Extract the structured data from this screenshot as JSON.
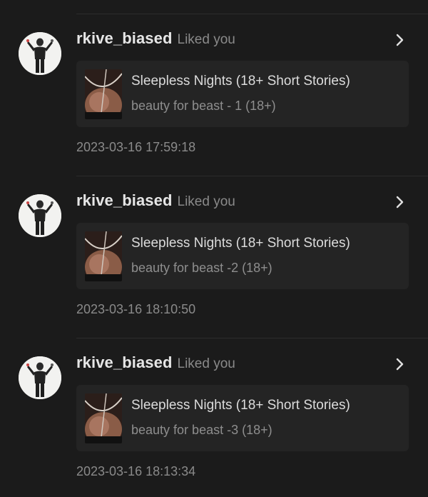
{
  "notifications": [
    {
      "username": "rkive_biased",
      "action": "Liked you",
      "story_title": "Sleepless Nights (18+ Short Stories)",
      "chapter_title": "beauty for beast - 1 (18+)",
      "timestamp": "2023-03-16 17:59:18"
    },
    {
      "username": "rkive_biased",
      "action": "Liked you",
      "story_title": "Sleepless Nights (18+ Short Stories)",
      "chapter_title": "beauty for beast -2 (18+)",
      "timestamp": "2023-03-16 18:10:50"
    },
    {
      "username": "rkive_biased",
      "action": "Liked you",
      "story_title": "Sleepless Nights (18+ Short Stories)",
      "chapter_title": "beauty for beast -3 (18+)",
      "timestamp": "2023-03-16 18:13:34"
    }
  ],
  "icons": {
    "avatar": "avatar-image",
    "cover": "book-cover-image",
    "chevron": "chevron-right-icon"
  },
  "colors": {
    "background": "#1b1b1b",
    "card": "#242424",
    "username": "#e6e6e6",
    "muted": "#8a8a8a"
  }
}
